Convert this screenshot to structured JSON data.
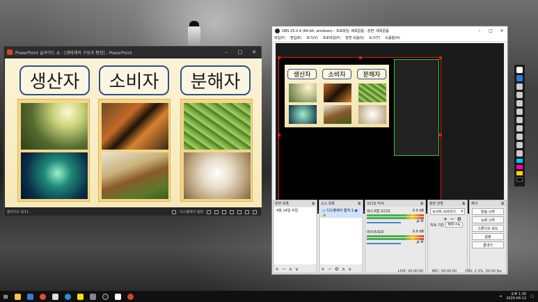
{
  "ppt": {
    "title": "PowerPoint 슬라이드 쇼 - [생태계의 구성과 평형] - PowerPoint",
    "slide_words": [
      "생산자",
      "소비자",
      "분해자"
    ],
    "status_left": "슬라이드 9/11",
    "status_display": "디스플레이 설정"
  },
  "obs": {
    "title": "OBS 25.0.4 (64-bit, windows) - 프로파일: 제목없음 - 장면: 제목없음",
    "menu": [
      "파일(F)",
      "편집(E)",
      "보기(V)",
      "프로파일(P)",
      "장면 모음(S)",
      "도구(T)",
      "도움말(H)"
    ],
    "docks": {
      "scenes": {
        "title": "장면 목록",
        "items": [
          "4월 14일 수업"
        ]
      },
      "sources": {
        "title": "소스 목록",
        "items": [
          "디스플레이 캡쳐 1"
        ]
      },
      "mixer": {
        "title": "오디오 믹서",
        "tracks": [
          {
            "name": "데스크탑 오디오",
            "db": "0.0 dB"
          },
          {
            "name": "마이크/보조",
            "db": "0.0 dB"
          }
        ]
      },
      "transitions": {
        "title": "장면 전환",
        "selected": "서서히 사라지기",
        "duration_label": "지속 기간",
        "duration_value": "300 ms"
      },
      "controls": {
        "title": "제어",
        "buttons": [
          "방송 시작",
          "녹화 시작",
          "스튜디오 모드",
          "설정",
          "끝내기"
        ]
      }
    },
    "status": {
      "live": "LIVE: 00:00:00",
      "rec": "REC: 00:00:00",
      "cpu": "CPU: 2.3%, 30.00 fps"
    }
  },
  "taskbar": {
    "time": "오후 1:35",
    "date": "2020-04-12"
  }
}
